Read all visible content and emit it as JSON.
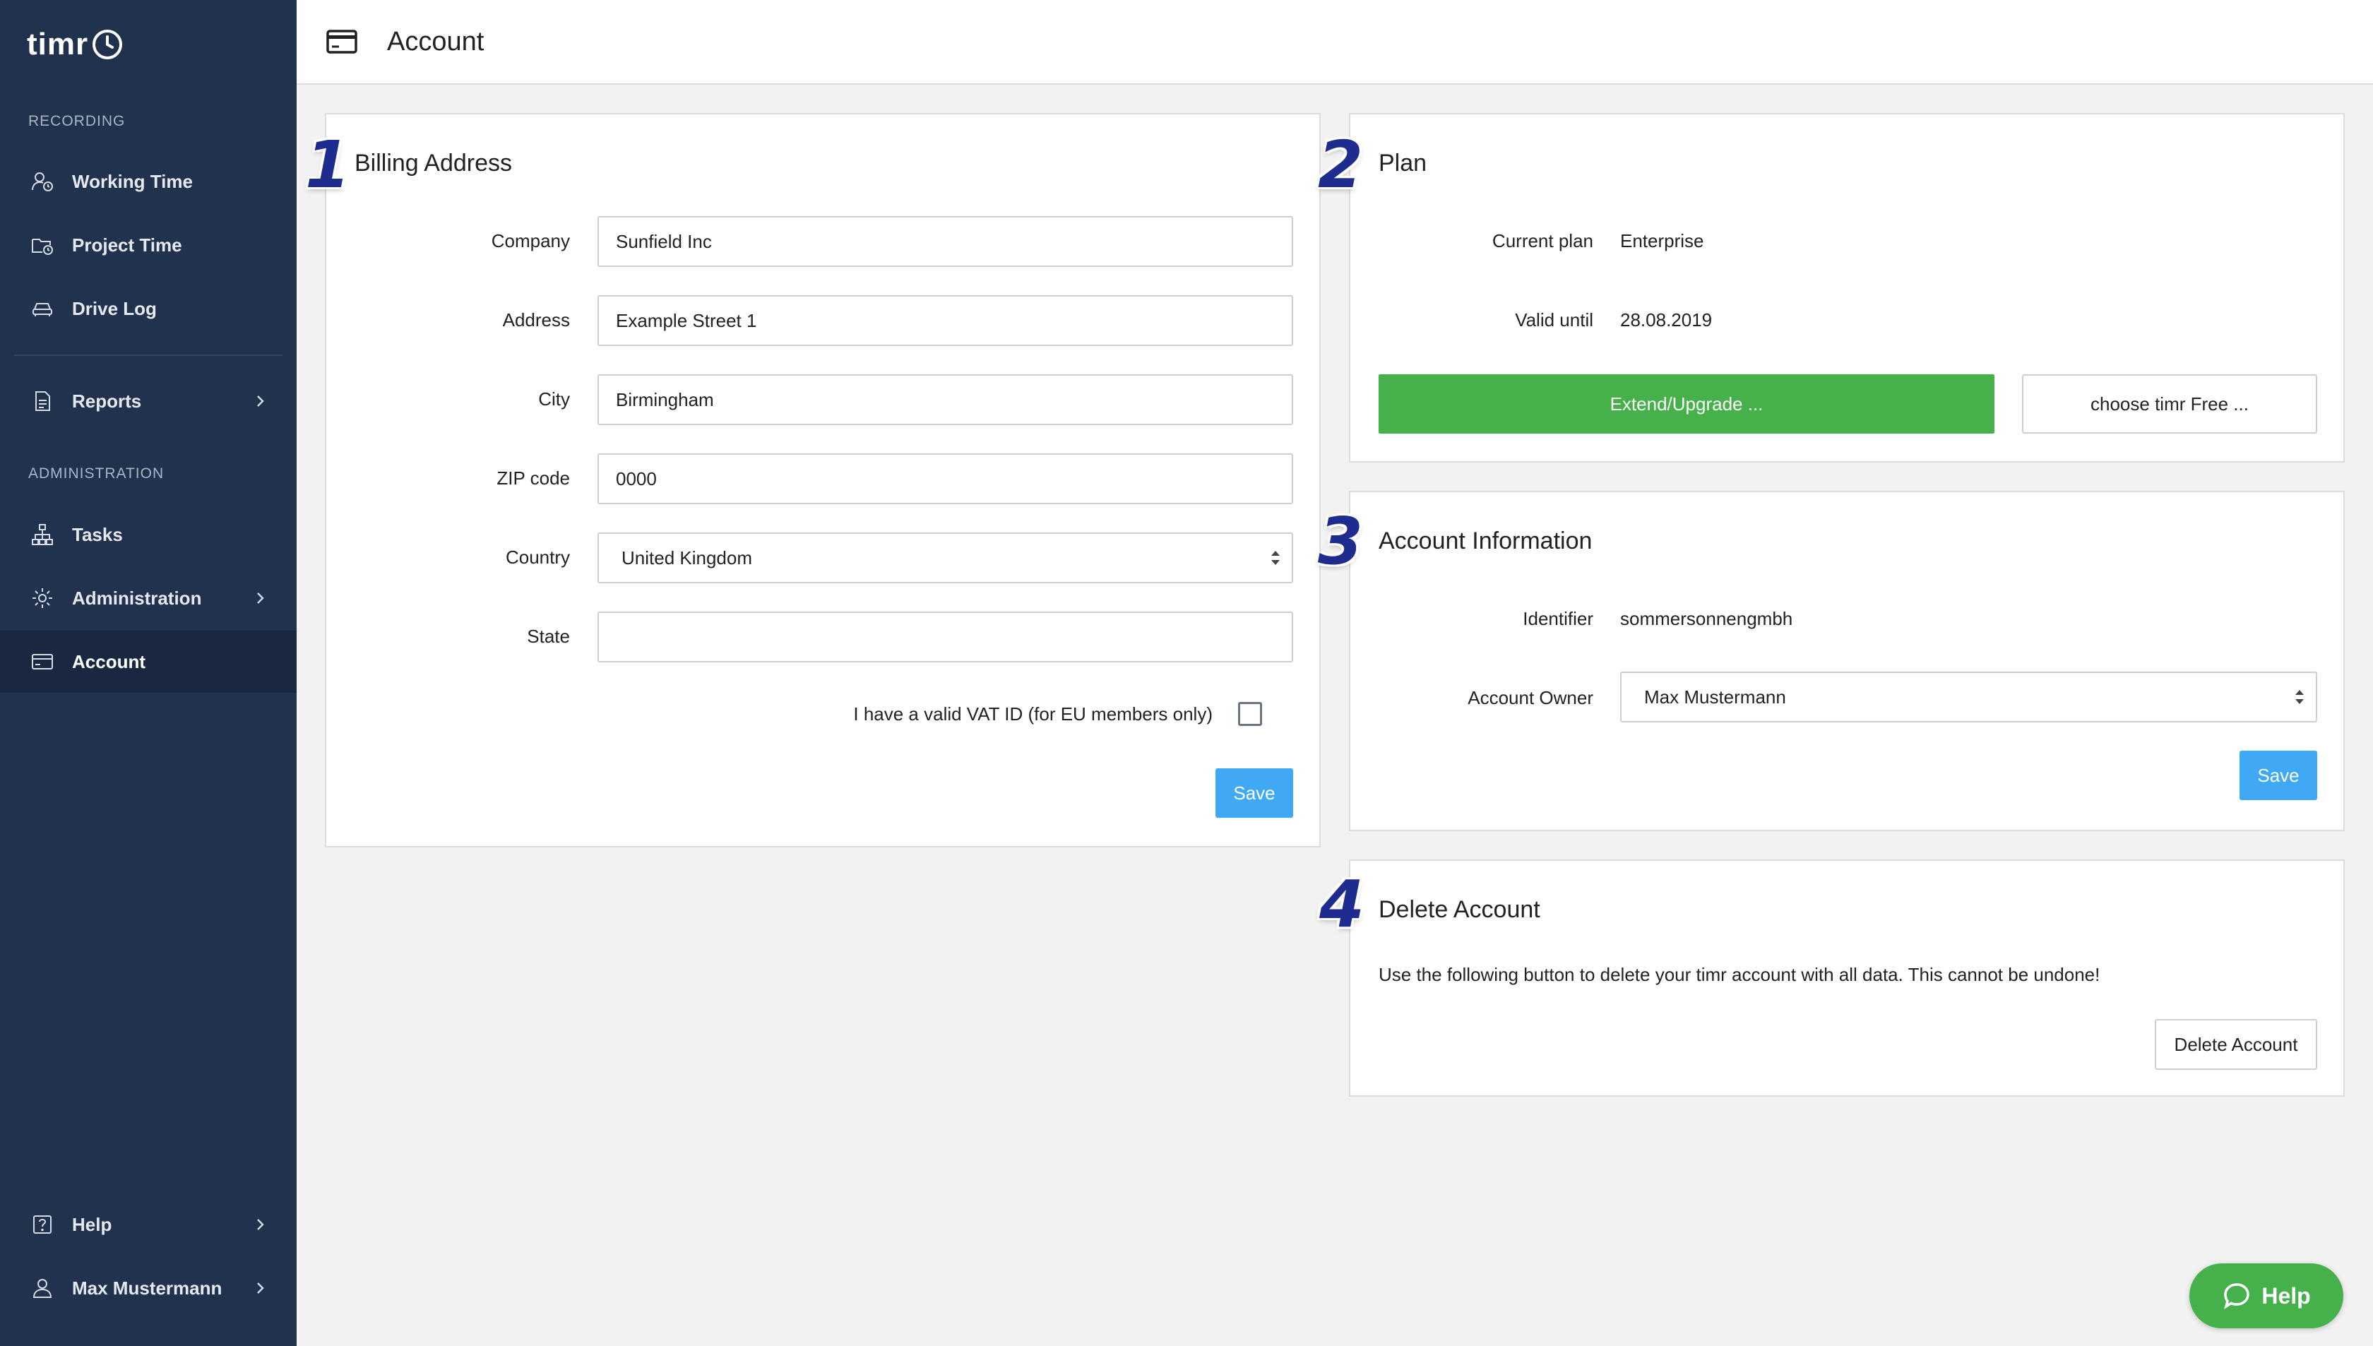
{
  "sidebar": {
    "logo": "timr",
    "sections": {
      "recording": "RECORDING",
      "administration": "ADMINISTRATION"
    },
    "items": {
      "working_time": {
        "label": "Working Time",
        "icon": "user-clock-icon"
      },
      "project_time": {
        "label": "Project Time",
        "icon": "folder-clock-icon"
      },
      "drive_log": {
        "label": "Drive Log",
        "icon": "car-icon"
      },
      "reports": {
        "label": "Reports",
        "icon": "document-icon"
      },
      "tasks": {
        "label": "Tasks",
        "icon": "hierarchy-icon"
      },
      "administration": {
        "label": "Administration",
        "icon": "gear-icon"
      },
      "account": {
        "label": "Account",
        "icon": "credit-card-icon"
      },
      "help": {
        "label": "Help",
        "icon": "question-icon"
      },
      "user": {
        "label": "Max Mustermann",
        "icon": "user-icon"
      }
    }
  },
  "header": {
    "title": "Account",
    "icon": "credit-card-icon"
  },
  "billing": {
    "step": "1",
    "title": "Billing Address",
    "labels": {
      "company": "Company",
      "address": "Address",
      "city": "City",
      "zip": "ZIP code",
      "country": "Country",
      "state": "State"
    },
    "values": {
      "company": "Sunfield Inc",
      "address": "Example Street 1",
      "city": "Birmingham",
      "zip": "0000",
      "country": "United Kingdom",
      "state": ""
    },
    "vat_label": "I have a valid VAT ID (for EU members only)",
    "save_label": "Save"
  },
  "plan": {
    "step": "2",
    "title": "Plan",
    "current_label": "Current plan",
    "current_value": "Enterprise",
    "valid_label": "Valid until",
    "valid_value": "28.08.2019",
    "upgrade_label": "Extend/Upgrade ...",
    "free_label": "choose timr Free ..."
  },
  "account_info": {
    "step": "3",
    "title": "Account Information",
    "identifier_label": "Identifier",
    "identifier_value": "sommersonnengmbh",
    "owner_label": "Account Owner",
    "owner_value": "Max Mustermann",
    "save_label": "Save"
  },
  "delete_account": {
    "step": "4",
    "title": "Delete Account",
    "description": "Use the following button to delete your timr account with all data. This cannot be undone!",
    "button_label": "Delete Account"
  },
  "help_fab": {
    "label": "Help",
    "icon": "chat-bubble-icon"
  },
  "colors": {
    "sidebar_bg": "#21324f",
    "accent_blue": "#3fa9f5",
    "accent_green": "#46b04a",
    "step_number": "#1e2b8f"
  }
}
